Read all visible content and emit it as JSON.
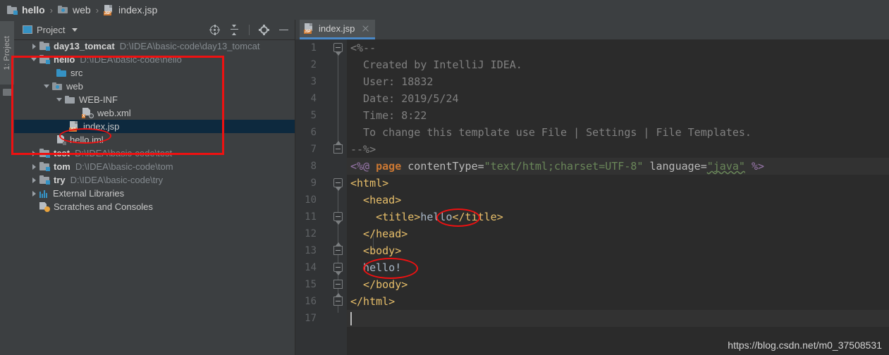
{
  "breadcrumb": {
    "items": [
      {
        "label": "hello",
        "icon": "module-icon",
        "bold": true
      },
      {
        "label": "web",
        "icon": "web-folder-icon",
        "bold": false
      },
      {
        "label": "index.jsp",
        "icon": "jsp-file-icon",
        "bold": false
      }
    ],
    "separator": "›"
  },
  "tool_strip": {
    "project_button_label": "1: Project"
  },
  "project_panel": {
    "title": "Project",
    "actions": [
      "locate-icon",
      "collapse-all-icon",
      "settings-gear-icon",
      "hide-icon"
    ],
    "tree": [
      {
        "name": "day13_tomcat",
        "path": "D:\\IDEA\\basic-code\\day13_tomcat",
        "icon": "module-icon",
        "arrow": "right",
        "indent": 0,
        "bold": true,
        "selected": false
      },
      {
        "name": "hello",
        "path": "D:\\IDEA\\basic-code\\hello",
        "icon": "module-icon",
        "arrow": "down",
        "indent": 0,
        "bold": true,
        "selected": false
      },
      {
        "name": "src",
        "path": "",
        "icon": "source-folder-icon",
        "arrow": "none",
        "indent": 2,
        "bold": false,
        "selected": false
      },
      {
        "name": "web",
        "path": "",
        "icon": "web-folder-icon",
        "arrow": "down",
        "indent": 1,
        "bold": false,
        "selected": false
      },
      {
        "name": "WEB-INF",
        "path": "",
        "icon": "folder-icon",
        "arrow": "down",
        "indent": 2,
        "bold": false,
        "selected": false
      },
      {
        "name": "web.xml",
        "path": "",
        "icon": "xml-file-icon",
        "arrow": "none",
        "indent": 4,
        "bold": false,
        "selected": false
      },
      {
        "name": "index.jsp",
        "path": "",
        "icon": "jsp-file-icon",
        "arrow": "none",
        "indent": 3,
        "bold": false,
        "selected": true
      },
      {
        "name": "hello.iml",
        "path": "",
        "icon": "iml-file-icon",
        "arrow": "none",
        "indent": 2,
        "bold": false,
        "selected": false
      },
      {
        "name": "test",
        "path": "D:\\IDEA\\basic-code\\test",
        "icon": "module-icon",
        "arrow": "right",
        "indent": 0,
        "bold": true,
        "selected": false
      },
      {
        "name": "tom",
        "path": "D:\\IDEA\\basic-code\\tom",
        "icon": "module-icon",
        "arrow": "right",
        "indent": 0,
        "bold": true,
        "selected": false
      },
      {
        "name": "try",
        "path": "D:\\IDEA\\basic-code\\try",
        "icon": "module-icon",
        "arrow": "right",
        "indent": 0,
        "bold": true,
        "selected": false
      },
      {
        "name": "External Libraries",
        "path": "",
        "icon": "library-icon",
        "arrow": "right",
        "indent": 0,
        "bold": false,
        "selected": false
      },
      {
        "name": "Scratches and Consoles",
        "path": "",
        "icon": "scratches-icon",
        "arrow": "none",
        "indent": 0,
        "bold": false,
        "selected": false
      }
    ]
  },
  "editor": {
    "tab": {
      "label": "index.jsp",
      "icon": "jsp-file-icon",
      "close": "close-icon"
    },
    "line_numbers": [
      1,
      2,
      3,
      4,
      5,
      6,
      7,
      8,
      9,
      10,
      11,
      12,
      13,
      14,
      15,
      16,
      17
    ],
    "lines": [
      {
        "n": 1,
        "text": "<%--"
      },
      {
        "n": 2,
        "text": "  Created by IntelliJ IDEA."
      },
      {
        "n": 3,
        "text": "  User: 18832"
      },
      {
        "n": 4,
        "text": "  Date: 2019/5/24"
      },
      {
        "n": 5,
        "text": "  Time: 8:22"
      },
      {
        "n": 6,
        "text": "  To change this template use File | Settings | File Templates."
      },
      {
        "n": 7,
        "text": "--%>"
      },
      {
        "n": 8,
        "text": "<%@ page contentType=\"text/html;charset=UTF-8\" language=\"java\" %>"
      },
      {
        "n": 9,
        "text": "<html>"
      },
      {
        "n": 10,
        "text": "  <head>"
      },
      {
        "n": 11,
        "text": "    <title>hello</title>"
      },
      {
        "n": 12,
        "text": "  </head>"
      },
      {
        "n": 13,
        "text": "  <body>"
      },
      {
        "n": 14,
        "text": "  hello!"
      },
      {
        "n": 15,
        "text": "  </body>"
      },
      {
        "n": 16,
        "text": "</html>"
      },
      {
        "n": 17,
        "text": ""
      }
    ],
    "watermark": "https://blog.csdn.net/m0_37508531"
  },
  "colors": {
    "panel_bg": "#3c3f41",
    "editor_bg": "#2b2b2b",
    "gutter_bg": "#313335",
    "selection_bg": "#0d293e",
    "accent_blue": "#3592c4",
    "tab_underline": "#4a88c7",
    "annotation_red": "#ee1111",
    "comment_grey": "#808080",
    "tag_yellow": "#e8bf6a",
    "keyword_orange": "#cc7832",
    "string_green": "#6a8759",
    "jsp_purple": "#9876aa"
  }
}
